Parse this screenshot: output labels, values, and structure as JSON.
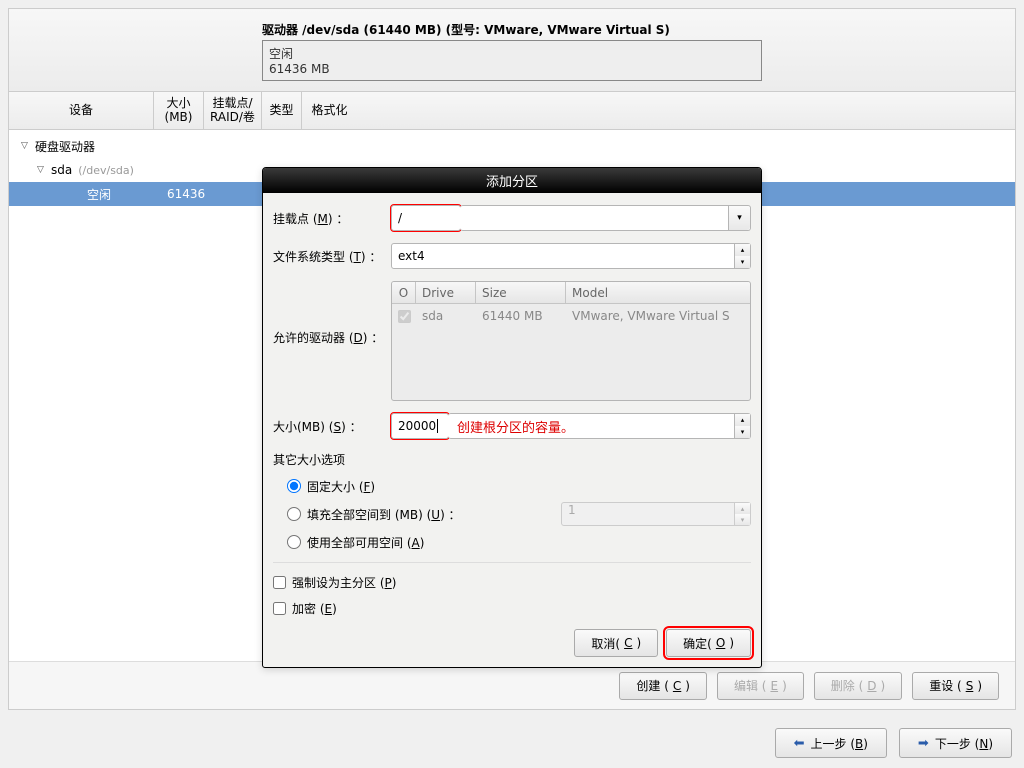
{
  "drive_header": {
    "title": "驱动器 /dev/sda (61440 MB) (型号: VMware, VMware Virtual S)",
    "state": "空闲",
    "size": "61436 MB"
  },
  "columns": {
    "device": "设备",
    "size": "大小\n(MB)",
    "mount_raid": "挂载点/\nRAID/卷",
    "type": "类型",
    "format": "格式化"
  },
  "tree": {
    "root_label": "硬盘驱动器",
    "sda_label": "sda",
    "sda_path": "(/dev/sda)",
    "free_label": "空闲",
    "free_size": "61436"
  },
  "dialog": {
    "title": "添加分区",
    "mount_label_pre": "挂载点 (",
    "mount_label_u": "M",
    "mount_label_post": ") ：",
    "mount_value": "/",
    "fs_label_pre": "文件系统类型 (",
    "fs_label_u": "T",
    "fs_label_post": ") ：",
    "fs_value": "ext4",
    "allowed_label_pre": "允许的驱动器 (",
    "allowed_label_u": "D",
    "allowed_label_post": ") ：",
    "drives_table": {
      "h1": "O",
      "h2": "Drive",
      "h3": "Size",
      "h4": "Model",
      "rows": [
        {
          "checked": true,
          "drive": "sda",
          "size": "61440 MB",
          "model": "VMware, VMware Virtual S"
        }
      ]
    },
    "size_label_pre": "大小(MB) (",
    "size_label_u": "S",
    "size_label_post": ") ：",
    "size_value": "20000",
    "size_annotation": "创建根分区的容量。",
    "other_size_label": "其它大小选项",
    "radio_fixed_pre": "固定大小 (",
    "radio_fixed_u": "F",
    "radio_fixed_post": ")",
    "radio_fill_pre": "填充全部空间到 (MB) (",
    "radio_fill_u": "U",
    "radio_fill_post": ") ：",
    "radio_fill_value": "1",
    "radio_all_pre": "使用全部可用空间 (",
    "radio_all_u": "A",
    "radio_all_post": ")",
    "force_primary_pre": "强制设为主分区 (",
    "force_primary_u": "P",
    "force_primary_post": ")",
    "encrypt_pre": "加密 (",
    "encrypt_u": "E",
    "encrypt_post": ")",
    "btn_cancel_pre": "取消(",
    "btn_cancel_u": "C",
    "btn_cancel_post": ")",
    "btn_ok_pre": "确定(",
    "btn_ok_u": "O",
    "btn_ok_post": ")"
  },
  "bottom": {
    "create_pre": "创建 (",
    "create_u": "C",
    "create_post": ")",
    "edit_pre": "编辑 (",
    "edit_u": "E",
    "edit_post": ")",
    "delete_pre": "删除 (",
    "delete_u": "D",
    "delete_post": ")",
    "reset_pre": "重设 (",
    "reset_u": "S",
    "reset_post": ")"
  },
  "nav": {
    "back_pre": "上一步 (",
    "back_u": "B",
    "back_post": ")",
    "next_pre": "下一步 (",
    "next_u": "N",
    "next_post": ")"
  }
}
